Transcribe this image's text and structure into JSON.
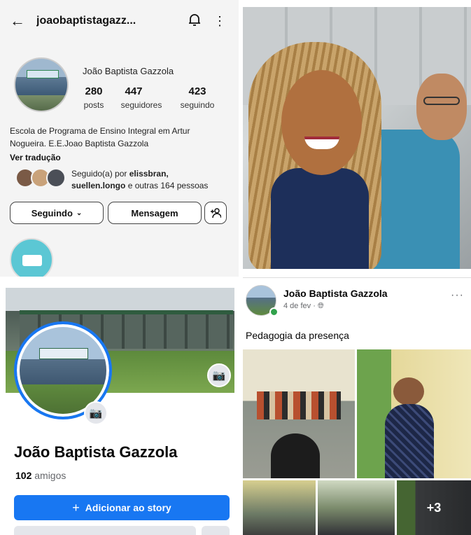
{
  "instagram": {
    "username": "joaobaptistagazz...",
    "display_name": "João Baptista Gazzola",
    "stats": [
      {
        "value": "280",
        "label": "posts"
      },
      {
        "value": "447",
        "label": "seguidores"
      },
      {
        "value": "423",
        "label": "seguindo"
      }
    ],
    "bio": "Escola de Programa de Ensino Integral em Artur Nogueira. E.E.Joao Baptista Gazzola",
    "translate_link": "Ver tradução",
    "followed_by_prefix": "Seguido(a) por",
    "followed_by_names": "elissbran,",
    "followed_by_names2": "suellen.longo",
    "followed_by_suffix": "e outras 164 pessoas",
    "following_button": "Seguindo",
    "message_button": "Mensagem",
    "icons": {
      "back": "back-arrow-icon",
      "bell": "bell-icon",
      "menu": "more-vertical-icon",
      "add_person": "add-person-icon",
      "chevron": "chevron-down-icon"
    }
  },
  "facebook_profile": {
    "name": "João Baptista Gazzola",
    "friends_count": "102",
    "friends_label": "amigos",
    "add_story_button": "Adicionar ao story",
    "add_story_icon": "+",
    "icons": {
      "camera": "camera-icon"
    },
    "colors": {
      "accent": "#1877f2"
    }
  },
  "facebook_post": {
    "author": "João Baptista Gazzola",
    "date": "4 de fev",
    "separator": "·",
    "privacy_icon": "public-globe-icon",
    "text": "Pedagogia da presença",
    "more_photos": "+3",
    "menu_dots": "···"
  }
}
